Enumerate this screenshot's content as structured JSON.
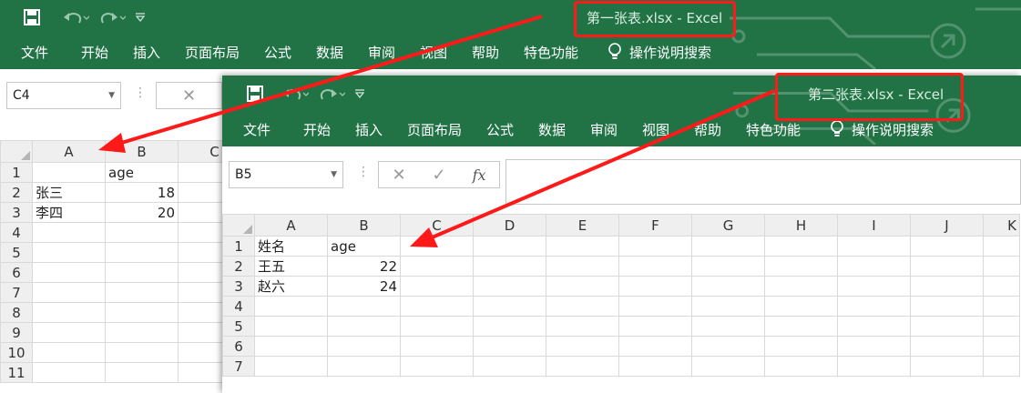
{
  "windows": [
    {
      "title": "第一张表.xlsx  -  Excel",
      "ribbon_tabs": [
        "文件",
        "开始",
        "插入",
        "页面布局",
        "公式",
        "数据",
        "审阅",
        "视图",
        "帮助",
        "特色功能"
      ],
      "tell_me": "操作说明搜索",
      "name_box": "C4",
      "columns": [
        "A",
        "B",
        "C"
      ],
      "rows": [
        {
          "n": "1",
          "a": "",
          "b": "age"
        },
        {
          "n": "2",
          "a": "张三",
          "b": "18"
        },
        {
          "n": "3",
          "a": "李四",
          "b": "20"
        },
        {
          "n": "4",
          "a": "",
          "b": ""
        },
        {
          "n": "5",
          "a": "",
          "b": ""
        },
        {
          "n": "6",
          "a": "",
          "b": ""
        },
        {
          "n": "7",
          "a": "",
          "b": ""
        },
        {
          "n": "8",
          "a": "",
          "b": ""
        },
        {
          "n": "9",
          "a": "",
          "b": ""
        },
        {
          "n": "10",
          "a": "",
          "b": ""
        },
        {
          "n": "11",
          "a": "",
          "b": ""
        }
      ]
    },
    {
      "title": "第二张表.xlsx  -  Excel",
      "ribbon_tabs": [
        "文件",
        "开始",
        "插入",
        "页面布局",
        "公式",
        "数据",
        "审阅",
        "视图",
        "帮助",
        "特色功能"
      ],
      "tell_me": "操作说明搜索",
      "name_box": "B5",
      "formula_symbol": "fx",
      "columns": [
        "A",
        "B",
        "C",
        "D",
        "E",
        "F",
        "G",
        "H",
        "I",
        "J",
        "K"
      ],
      "rows": [
        {
          "n": "1",
          "a": "姓名",
          "b": "age"
        },
        {
          "n": "2",
          "a": "王五",
          "b": "22"
        },
        {
          "n": "3",
          "a": "赵六",
          "b": "24"
        },
        {
          "n": "4",
          "a": "",
          "b": ""
        },
        {
          "n": "5",
          "a": "",
          "b": ""
        },
        {
          "n": "6",
          "a": "",
          "b": ""
        },
        {
          "n": "7",
          "a": "",
          "b": ""
        }
      ]
    }
  ],
  "colors": {
    "excel_green": "#217346",
    "annotation_red": "#ff1a1a"
  },
  "icons": [
    "save-icon",
    "undo-icon",
    "redo-icon",
    "customize-qat-icon",
    "lightbulb-icon",
    "cancel-x-icon",
    "enter-check-icon"
  ]
}
